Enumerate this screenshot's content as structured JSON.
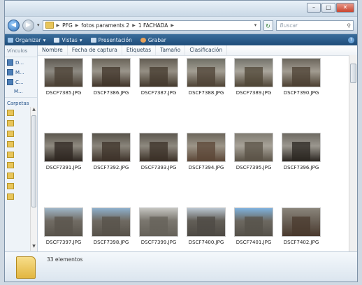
{
  "address": {
    "segments": [
      "PFG",
      "fotos paraments 2",
      "1 FACHADA"
    ]
  },
  "search": {
    "placeholder": "Buscar"
  },
  "toolbar": {
    "organize": "Organizar",
    "views": "Vistas",
    "slideshow": "Presentación",
    "burn": "Grabar"
  },
  "leftpane": {
    "links_label": "Vínculos",
    "links": [
      "D...",
      "M...",
      "C...",
      "M..."
    ],
    "folders_label": "Carpetas"
  },
  "columns": [
    "Nombre",
    "Fecha de captura",
    "Etiquetas",
    "Tamaño",
    "Clasificación"
  ],
  "files": [
    {
      "name": "DSCF7385.JPG",
      "colors": [
        "#5f5a52",
        "#8d8a82",
        "#4a3f33"
      ]
    },
    {
      "name": "DSCF7386.JPG",
      "colors": [
        "#6a6459",
        "#9a958b",
        "#3f3328"
      ]
    },
    {
      "name": "DSCF7387.JPG",
      "colors": [
        "#635d53",
        "#958f84",
        "#43382c"
      ]
    },
    {
      "name": "DSCF7388.JPG",
      "colors": [
        "#707066",
        "#a39e93",
        "#4d4234"
      ]
    },
    {
      "name": "DSCF7389.JPG",
      "colors": [
        "#74736b",
        "#aaa69c",
        "#4f4536"
      ]
    },
    {
      "name": "DSCF7390.JPG",
      "colors": [
        "#6b665c",
        "#a29c91",
        "#4b3f31"
      ]
    },
    {
      "name": "DSCF7391.JPG",
      "colors": [
        "#5c574e",
        "#8f8a80",
        "#2d2620"
      ]
    },
    {
      "name": "DSCF7392.JPG",
      "colors": [
        "#58534a",
        "#8a857b",
        "#3c3128"
      ]
    },
    {
      "name": "DSCF7393.JPG",
      "colors": [
        "#5d584f",
        "#8e897f",
        "#3a2f26"
      ]
    },
    {
      "name": "DSCF7394.JPG",
      "colors": [
        "#6c665b",
        "#9c9588",
        "#5b4636"
      ]
    },
    {
      "name": "DSCF7395.JPG",
      "colors": [
        "#817c72",
        "#a7a298",
        "#5a5246"
      ]
    },
    {
      "name": "DSCF7396.JPG",
      "colors": [
        "#6e6a62",
        "#9b978f",
        "#2a2520"
      ]
    },
    {
      "name": "DSCF7397.JPG",
      "colors": [
        "#9fb6c8",
        "#716c64",
        "#59544c"
      ]
    },
    {
      "name": "DSCF7398.JPG",
      "colors": [
        "#8eb0cc",
        "#6f6a62",
        "#57524a"
      ]
    },
    {
      "name": "DSCF7399.JPG",
      "colors": [
        "#c4c4c0",
        "#7a766e",
        "#66625a"
      ]
    },
    {
      "name": "DSCF7400.JPG",
      "colors": [
        "#b9c5cf",
        "#625e57",
        "#4e4a44"
      ]
    },
    {
      "name": "DSCF7401.JPG",
      "colors": [
        "#7fb2de",
        "#6d6961",
        "#55514a"
      ]
    },
    {
      "name": "DSCF7402.JPG",
      "colors": [
        "#8a857b",
        "#6b6258",
        "#4a3a2e"
      ]
    }
  ],
  "status": {
    "count": "33 elementos"
  },
  "icons": {
    "back": "back-arrow-icon",
    "forward": "forward-arrow-icon",
    "refresh": "refresh-icon",
    "search": "search-icon",
    "folder": "folder-icon"
  }
}
